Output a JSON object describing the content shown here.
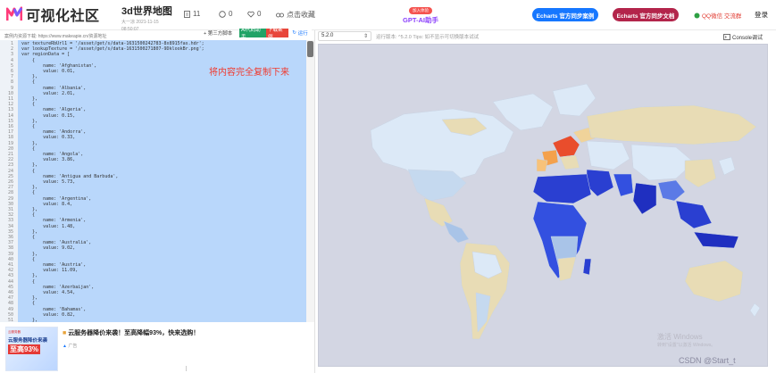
{
  "header": {
    "logo_text": "可视化社区",
    "page_title": "3d世界地图",
    "page_sub1": "大一凉 2021-11-15",
    "page_sub2": "08:50:07",
    "pages_count": "11",
    "comments_count": "0",
    "likes_count": "0",
    "collect_label": "点击收藏",
    "ai_tag": "加入体验",
    "ai_label": "GPT-AI助手",
    "btn_examples": "Echarts 官方同步案例",
    "btn_docs": "Echarts 官方同步文档",
    "qq_label": "QQ微信 交流群",
    "login_label": "登录"
  },
  "editor": {
    "address_label": "案例内资源下载: https://www.makeapie.cn/资源地址",
    "third_party_label": "第三方脚本",
    "ai_btn_label": "AI代码助手",
    "download_btn_label": "下载案例",
    "run_btn_label": "运行",
    "overlay_note": "将内容完全复制下来",
    "lines": [
      "var textureRbUrl1 = '/asset/get/s/data-1631500242783-8x8915fas.hdr';",
      "var lookupTexture = '/asset/get/s/data-1631500271807-9DklookBr.png';",
      "var regionData = [",
      "    {",
      "        name: 'Afghanistan',",
      "        value: 0.01,",
      "    },",
      "    {",
      "        name: 'Albania',",
      "        value: 2.01,",
      "    },",
      "    {",
      "        name: 'Algeria',",
      "        value: 0.15,",
      "    },",
      "    {",
      "        name: 'Andorra',",
      "        value: 0.33,",
      "    },",
      "    {",
      "        name: 'Angola',",
      "        value: 3.86,",
      "    },",
      "    {",
      "        name: 'Antigua and Barbuda',",
      "        value: 5.73,",
      "    },",
      "    {",
      "        name: 'Argentina',",
      "        value: 8.4,",
      "    },",
      "    {",
      "        name: 'Armenia',",
      "        value: 1.48,",
      "    },",
      "    {",
      "        name: 'Australia',",
      "        value: 9.02,",
      "    },",
      "    {",
      "        name: 'Austria',",
      "        value: 11.09,",
      "    },",
      "    {",
      "        name: 'Azerbaijan',",
      "        value: 4.54,",
      "    },",
      "    {",
      "        name: 'Bahamas',",
      "        value: 0.82,",
      "    },"
    ]
  },
  "ad": {
    "img_tag": "云服务器",
    "img_title": "云服务器降价来袭",
    "img_percent": "至高93%",
    "title": "云服务器降价来袭！至高降幅93%，快来选购！",
    "tag": "广告"
  },
  "preview": {
    "version": "5.2.0",
    "version_info": "运行版本: ^5.2.0  Tips: 如不显示可切换版本试试",
    "console_label": "Console调试",
    "watermark_title": "激活 Windows",
    "watermark_sub": "转到\"设置\"以激活 Windows。",
    "csdn_credit": "CSDN @Start_t"
  },
  "colors": {
    "selection": "#b9d7fb",
    "map_bg": "#d3d6e3",
    "land_light": "#e8dcb5",
    "land_blue": "#2a3fd1",
    "land_pale": "#dce9f7",
    "accent_blue": "#1677ff",
    "accent_red": "#b3254b"
  }
}
